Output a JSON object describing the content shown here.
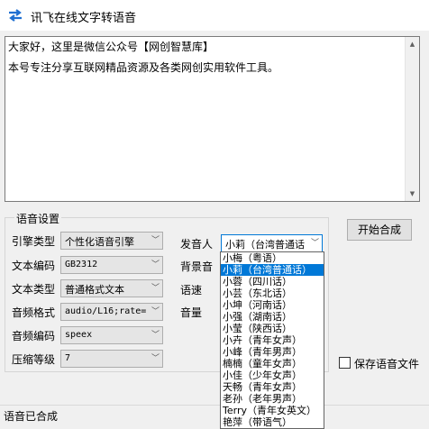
{
  "window": {
    "title": "讯飞在线文字转语音"
  },
  "text_area": {
    "lines": [
      "大家好，这里是微信公众号【网创智慧库】",
      "本号专注分享互联网精品资源及各类网创实用软件工具。"
    ]
  },
  "settings": {
    "group_title": "语音设置",
    "engine": {
      "label": "引擎类型",
      "value": "个性化语音引擎"
    },
    "encoding": {
      "label": "文本编码",
      "value": "GB2312"
    },
    "text_type": {
      "label": "文本类型",
      "value": "普通格式文本"
    },
    "audio_format": {
      "label": "音频格式",
      "value": "audio/L16;rate="
    },
    "audio_codec": {
      "label": "音频编码",
      "value": "speex"
    },
    "compression": {
      "label": "压缩等级",
      "value": "7"
    },
    "speaker": {
      "label": "发音人",
      "value": "小莉（台湾普通话"
    },
    "background_label": "背景音",
    "speed_label": "语速",
    "volume_label": "音量"
  },
  "start_button": {
    "label": "开始合成"
  },
  "save_audio": {
    "label": "保存语音文件",
    "checked": false
  },
  "speaker_dropdown": {
    "options": [
      "小梅（粤语）",
      "小莉（台湾普通话）",
      "小蓉（四川话）",
      "小芸（东北话）",
      "小坤（河南话）",
      "小强（湖南话）",
      "小莹（陕西话）",
      "小卉（青年女声）",
      "小峰（青年男声）",
      "楠楠（童年女声）",
      "小佳（少年女声）",
      "天畅（青年女声）",
      "老孙（老年男声）",
      "Terry（青年女英文）",
      "艳萍（带语气）"
    ],
    "selected_index": 1
  },
  "status_bar": {
    "text": "语音已合成"
  },
  "colors": {
    "selection": "#0078d7",
    "icon": "#1f6fd1"
  }
}
